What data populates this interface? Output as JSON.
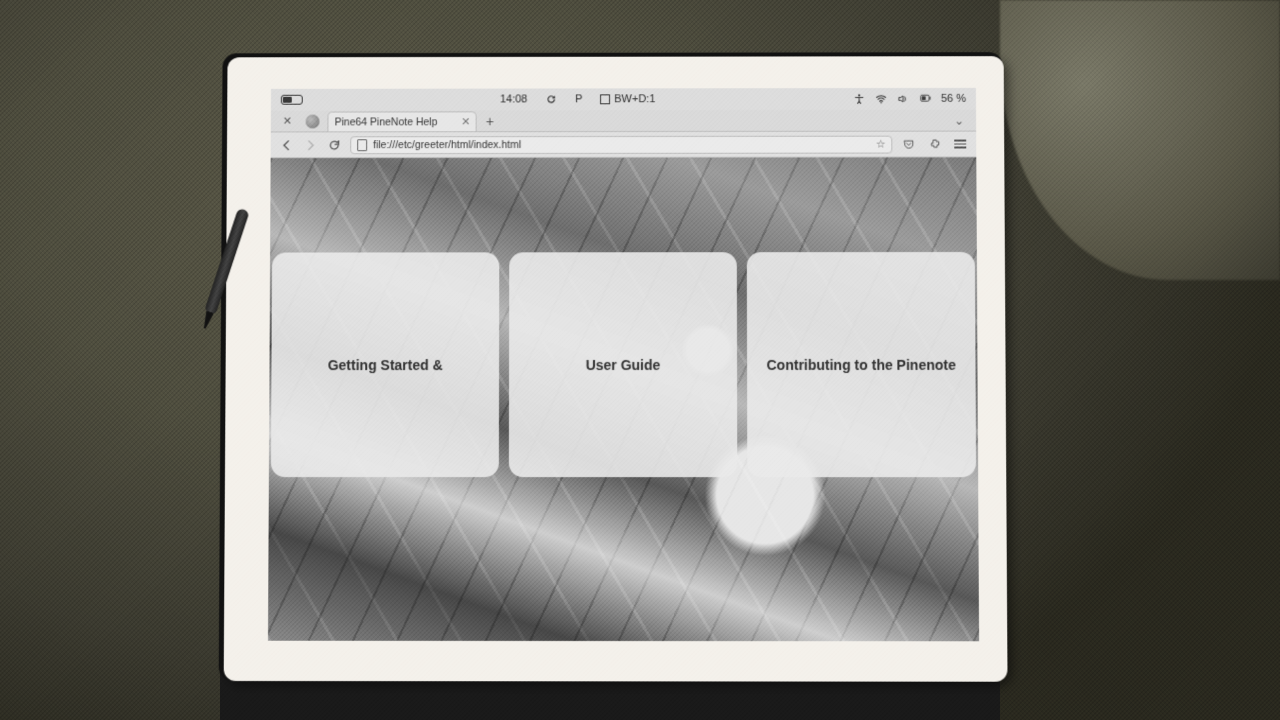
{
  "statusbar": {
    "clock": "14:08",
    "mode_letter": "P",
    "mode_label": "BW+D:1",
    "battery_pct": "56 %"
  },
  "browser": {
    "tab_title": "Pine64 PineNote Help",
    "url": "file:///etc/greeter/html/index.html"
  },
  "page": {
    "cards": [
      {
        "label": "Getting Started &"
      },
      {
        "label": "User Guide"
      },
      {
        "label": "Contributing to the Pinenote"
      }
    ]
  }
}
